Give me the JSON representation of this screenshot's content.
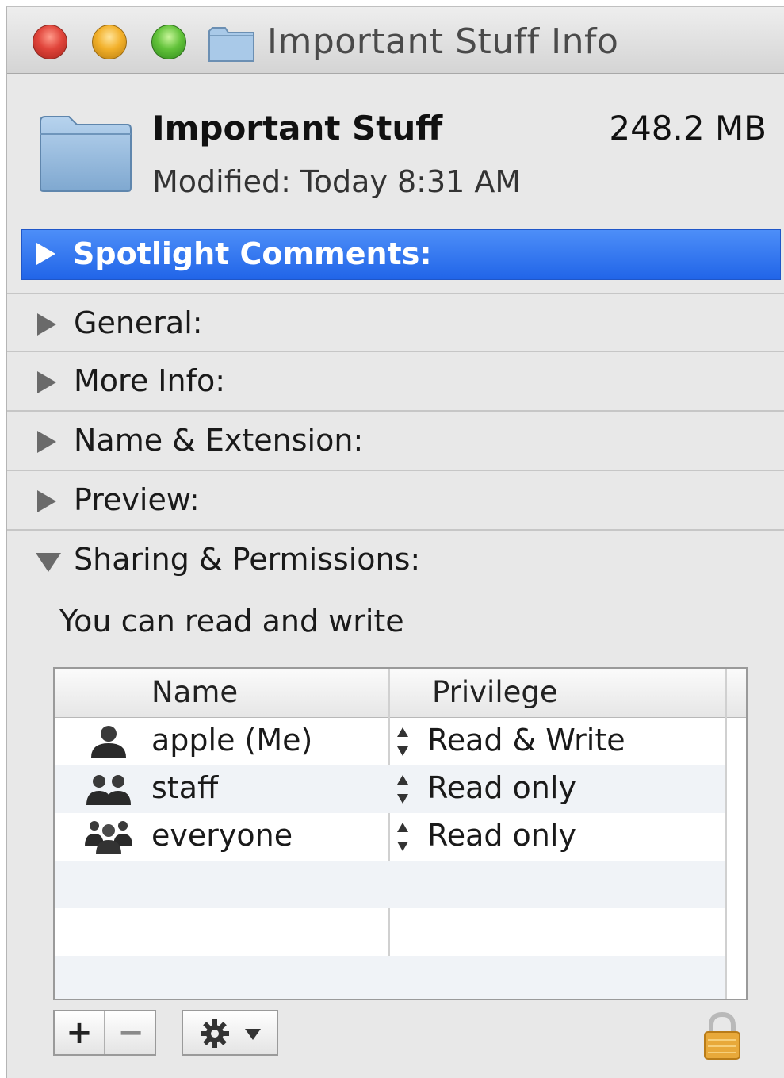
{
  "window": {
    "title": "Important Stuff Info"
  },
  "header": {
    "name": "Important Stuff",
    "size": "248.2 MB",
    "modified": "Modified: Today 8:31 AM"
  },
  "sections": {
    "spotlight": "Spotlight Comments:",
    "general": "General:",
    "more_info": "More Info:",
    "name_extension": "Name & Extension:",
    "preview": "Preview:",
    "sharing": "Sharing & Permissions:"
  },
  "permissions": {
    "summary": "You can read and write",
    "columns": {
      "name": "Name",
      "privilege": "Privilege"
    },
    "rows": [
      {
        "name": "apple (Me)",
        "privilege": "Read & Write",
        "icon": "single-user-icon"
      },
      {
        "name": "staff",
        "privilege": "Read only",
        "icon": "group-icon"
      },
      {
        "name": "everyone",
        "privilege": "Read only",
        "icon": "everyone-icon"
      }
    ]
  },
  "toolbar": {
    "add_label": "+",
    "remove_label": "−"
  },
  "colors": {
    "selection_blue": "#2a6ff0",
    "close": "#e0443a",
    "minimize": "#f2b02a",
    "zoom": "#62c23a",
    "lock": "#e8a93a"
  }
}
